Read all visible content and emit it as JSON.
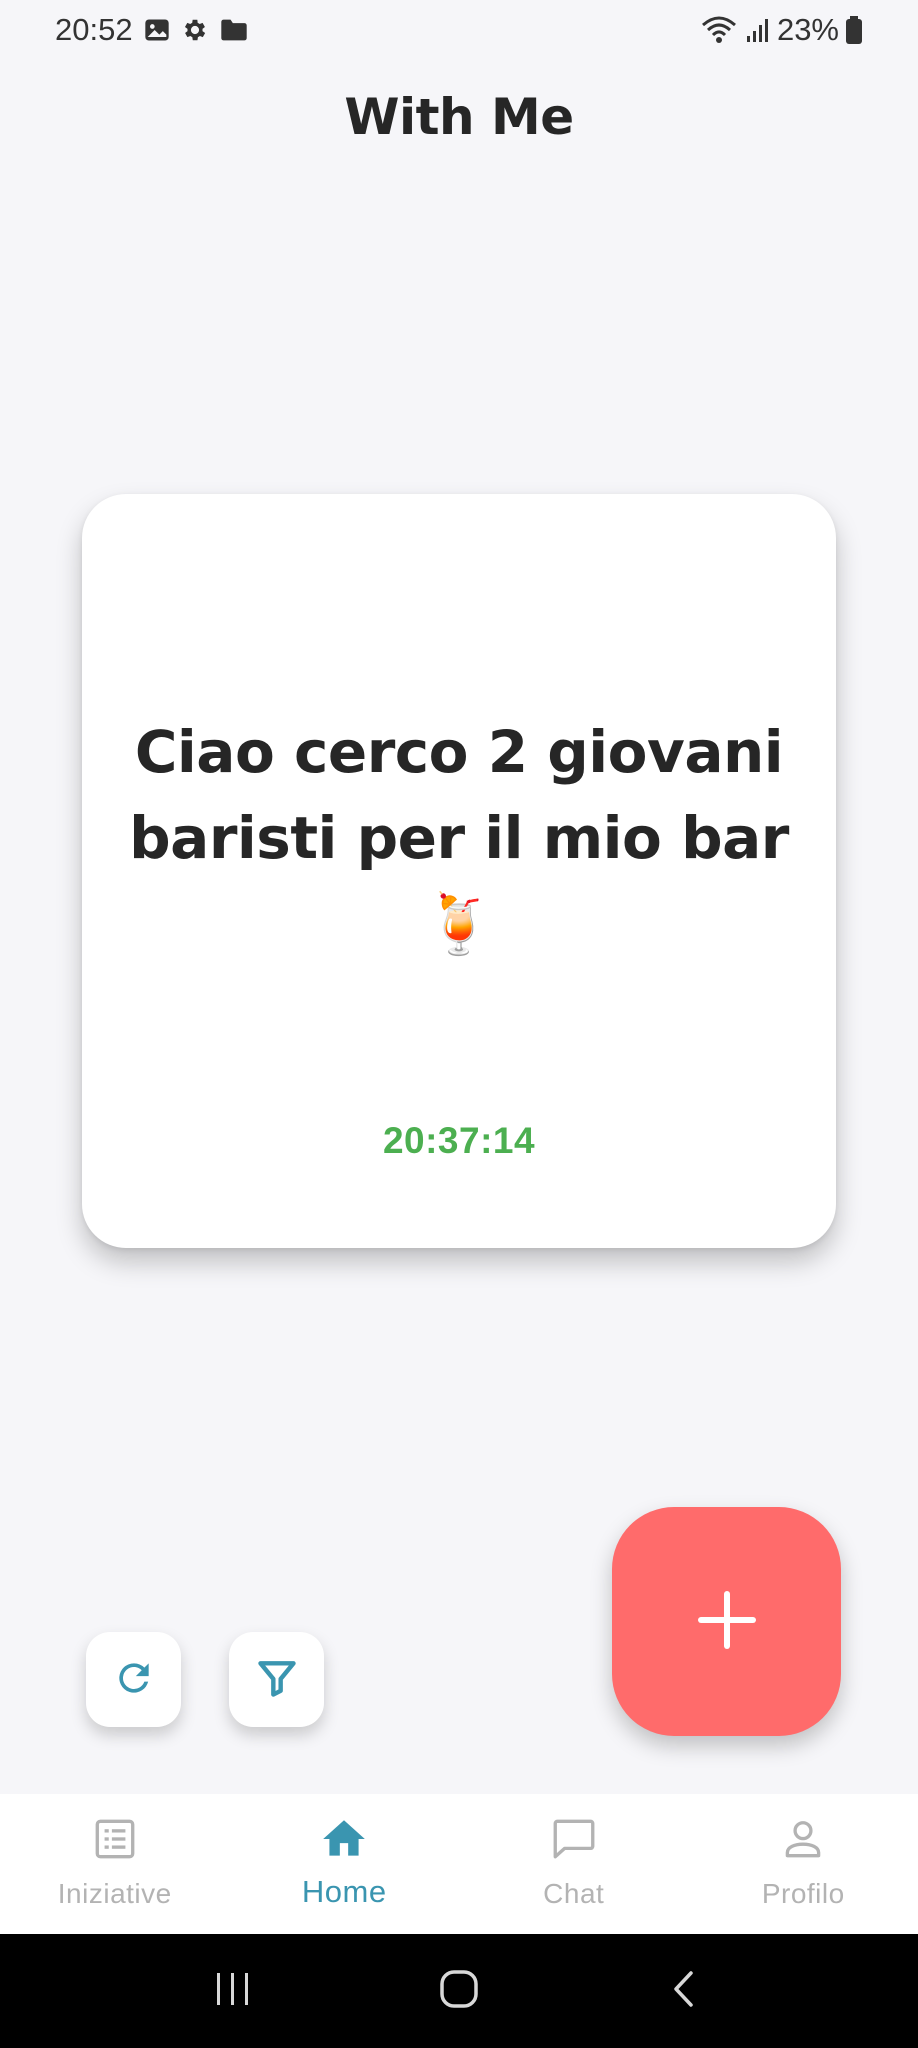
{
  "status_bar": {
    "time": "20:52",
    "battery": "23%",
    "icons_left": [
      "image-icon",
      "gear-icon",
      "folder-icon"
    ],
    "icons_right": [
      "wifi-icon",
      "signal-icon",
      "battery-icon"
    ]
  },
  "header": {
    "title": "With Me"
  },
  "card": {
    "text": "Ciao cerco 2 giovani baristi per il mio bar🍹",
    "time": "20:37:14"
  },
  "actions": {
    "refresh_icon": "refresh-icon",
    "filter_icon": "filter-icon",
    "add_icon": "plus-icon"
  },
  "nav": {
    "items": [
      {
        "label": "Iniziative",
        "icon": "list-icon",
        "active": false
      },
      {
        "label": "Home",
        "icon": "home-icon",
        "active": true
      },
      {
        "label": "Chat",
        "icon": "chat-icon",
        "active": false
      },
      {
        "label": "Profilo",
        "icon": "profile-icon",
        "active": false
      }
    ]
  },
  "colors": {
    "accent": "#3a95b0",
    "fab": "#ff6b6b",
    "time_green": "#4caf50",
    "background": "#f6f6f9"
  }
}
